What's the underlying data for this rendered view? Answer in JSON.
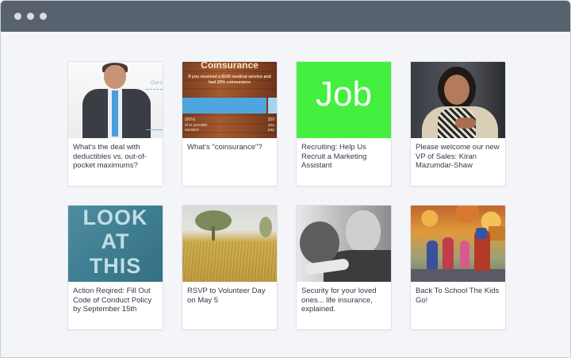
{
  "window": {
    "controls": [
      "dot",
      "dot",
      "dot"
    ]
  },
  "cards": [
    {
      "id": "deductibles",
      "caption": "What's the deal with deductibles vs. out-of-pocket maximums?",
      "thumb": {
        "label": "Out-o"
      }
    },
    {
      "id": "coinsurance",
      "caption": "What's \"coinsurance\"?",
      "thumb": {
        "title": "Coinsurance",
        "subtitle": "If you received a $100 medical service and had 20% coinsurance",
        "foot_left": "(80%)\nid to provider\nsurance",
        "foot_right": "$20\nyou\npay"
      }
    },
    {
      "id": "recruiting",
      "caption": "Recruiting: Help Us Recruit a Marketing Assistant",
      "thumb": {
        "word": "Job"
      }
    },
    {
      "id": "vp-sales",
      "caption": "Please welcome our new VP of Sales: Kiran Mazumdar-Shaw",
      "thumb": {}
    },
    {
      "id": "conduct-policy",
      "caption": "Action Reqired: Fill Out Code of Conduct Policy by September 15th",
      "thumb": {
        "line1": "LOOK",
        "line2": "AT",
        "line3": "THIS"
      }
    },
    {
      "id": "volunteer-day",
      "caption": "RSVP to Volunteer Day on May 5",
      "thumb": {}
    },
    {
      "id": "life-insurance",
      "caption": "Security for your loved ones... life insurance, explained.",
      "thumb": {}
    },
    {
      "id": "back-to-school",
      "caption": "Back To School The Kids Go!",
      "thumb": {}
    }
  ],
  "colors": {
    "titlebar": "#58626f",
    "canvas": "#f4f5f9",
    "job_green": "#44ef3f",
    "bar_blue": "#4fa5df"
  }
}
